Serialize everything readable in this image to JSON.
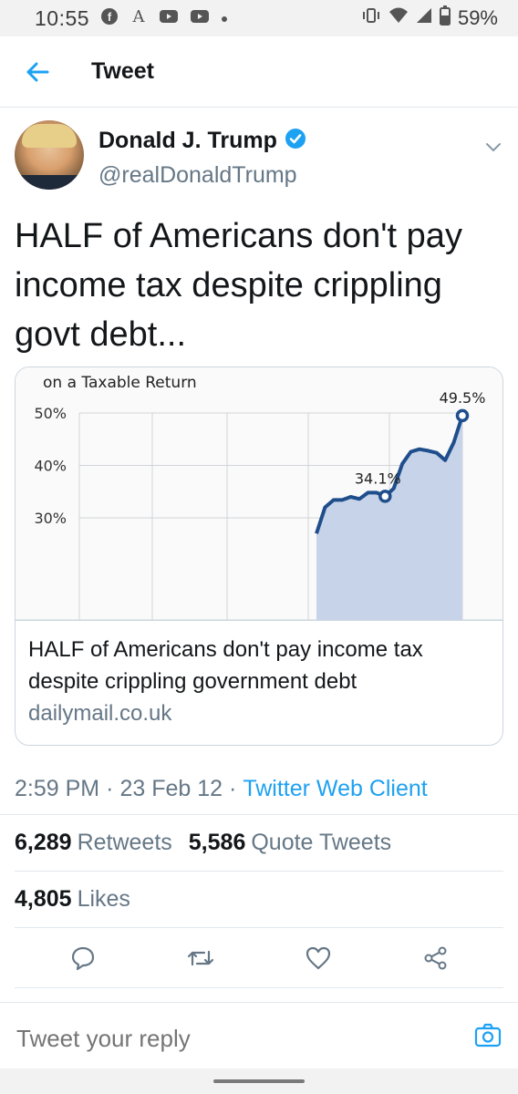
{
  "status_bar": {
    "time": "10:55",
    "battery": "59%",
    "left_icons": [
      "facebook-icon",
      "font-icon",
      "youtube-icon",
      "youtube-icon",
      "dot-icon"
    ],
    "right_icons": [
      "vibrate-icon",
      "wifi-icon",
      "signal-icon",
      "battery-icon"
    ]
  },
  "header": {
    "title": "Tweet"
  },
  "tweet": {
    "author_name": "Donald J. Trump",
    "author_handle": "@realDonaldTrump",
    "verified_color": "#1da1f2",
    "text": "HALF of Americans don't pay income tax despite crippling govt debt...",
    "card": {
      "title": "HALF of Americans don't pay income tax despite crippling government debt",
      "domain": "dailymail.co.uk",
      "chart_data": {
        "type": "area",
        "title": "on a Taxable Return",
        "ylabel": "",
        "ylim": [
          30,
          50
        ],
        "y_ticks": [
          "50%",
          "40%",
          "30%"
        ],
        "x": [
          1,
          2,
          3,
          4,
          5,
          6,
          7,
          8,
          9,
          10,
          11,
          12,
          13,
          14,
          15,
          16,
          17,
          18,
          19,
          20
        ],
        "values": [
          27.0,
          32.0,
          33.4,
          33.4,
          34.0,
          33.6,
          34.8,
          34.8,
          34.1,
          35.6,
          40.3,
          42.6,
          43.1,
          42.8,
          42.4,
          41.0,
          44.4,
          49.5
        ],
        "annotations": [
          {
            "label": "34.1%",
            "index": 8
          },
          {
            "label": "49.5%",
            "index": 17
          }
        ],
        "line_color": "#1f4e8c",
        "fill_color": "#c7d3e8"
      }
    },
    "time": "2:59 PM",
    "date": "23 Feb 12",
    "client": "Twitter Web Client",
    "retweets": "6,289",
    "retweets_label": "Retweets",
    "quote_tweets": "5,586",
    "quote_tweets_label": "Quote Tweets",
    "likes": "4,805",
    "likes_label": "Likes"
  },
  "reply": {
    "placeholder": "Tweet your reply"
  }
}
